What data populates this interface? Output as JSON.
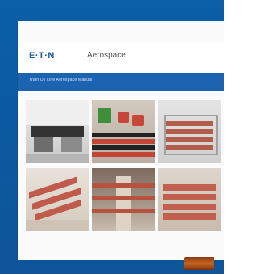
{
  "document": {
    "brand": "E·T·N",
    "product": "Aerospace",
    "subtitle": "Train Oil Line Aerospace Manual"
  },
  "photos": [
    {
      "name": "seating-area-photo"
    },
    {
      "name": "red-seat-photo"
    },
    {
      "name": "galley-photo"
    },
    {
      "name": "aisle-photo"
    },
    {
      "name": "cabin-interior-photo"
    },
    {
      "name": "seat-row-photo"
    }
  ],
  "colors": {
    "background_blue": "#0a5fa8",
    "band_blue": "#1c63b2",
    "logo_blue": "#1a55a0",
    "accent_orange": "#c8661d"
  }
}
